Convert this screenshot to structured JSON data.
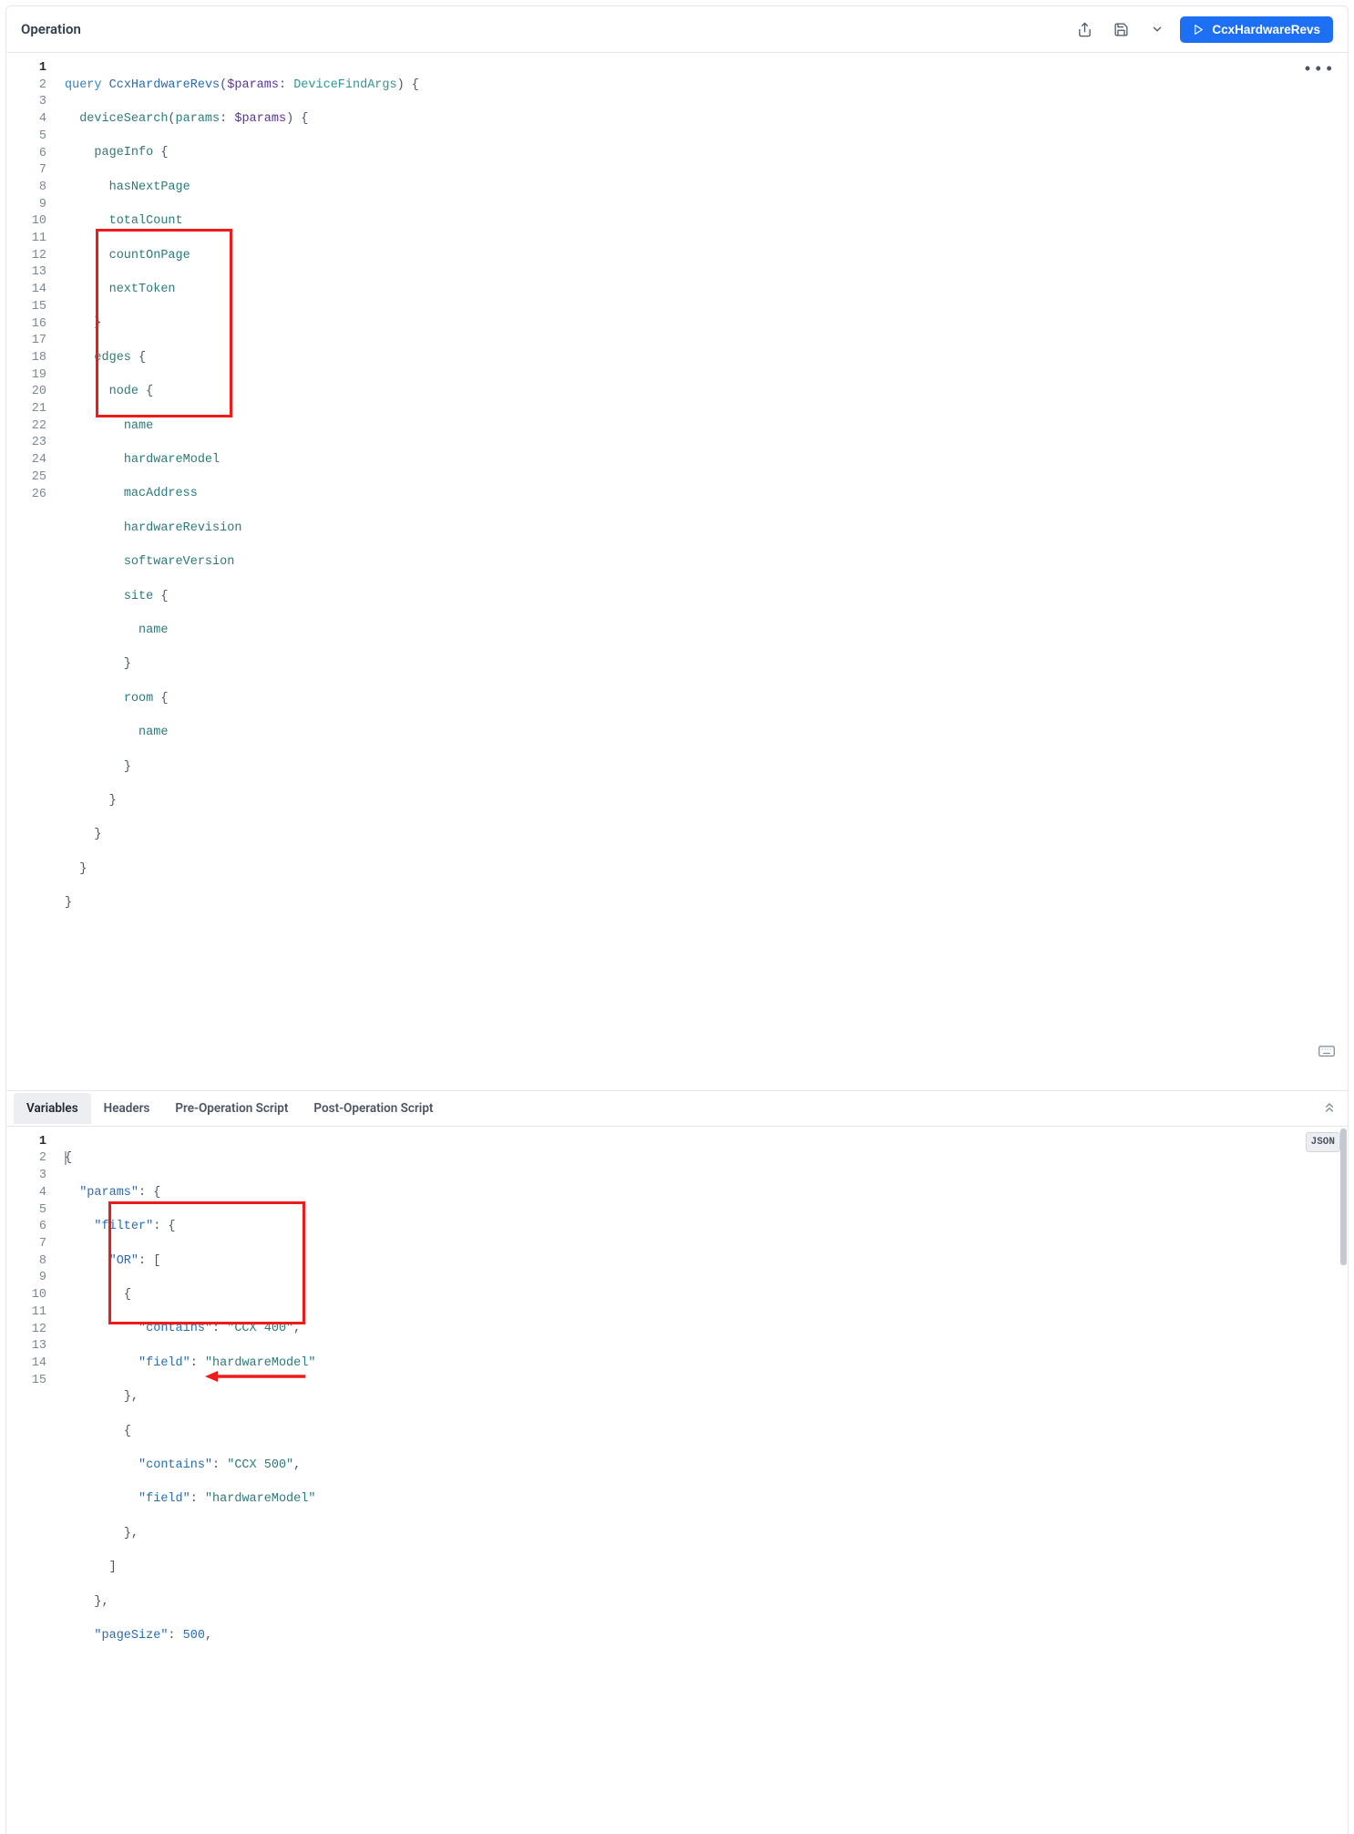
{
  "header": {
    "title": "Operation",
    "run_label": "CcxHardwareRevs"
  },
  "tabs": {
    "variables": "Variables",
    "headers": "Headers",
    "pre_op": "Pre-Operation Script",
    "post_op": "Post-Operation Script",
    "lang_badge": "JSON"
  },
  "query_lines": {
    "l1_kw": "query",
    "l1_name": "CcxHardwareRevs",
    "l1_var": "$params",
    "l1_type": "DeviceFindArgs",
    "l2_field": "deviceSearch",
    "l2_arg": "params",
    "l2_var": "$params",
    "l3": "pageInfo",
    "l4": "hasNextPage",
    "l5": "totalCount",
    "l6": "countOnPage",
    "l7": "nextToken",
    "l9": "edges",
    "l10": "node",
    "l11": "name",
    "l12": "hardwareModel",
    "l13": "macAddress",
    "l14": "hardwareRevision",
    "l15": "softwareVersion",
    "l16": "site",
    "l17": "name",
    "l19": "room",
    "l20": "name"
  },
  "vars_lines": {
    "l2_key": "\"params\"",
    "l3_key": "\"filter\"",
    "l4_key": "\"OR\"",
    "l6_key": "\"contains\"",
    "l6_val": "\"CCX 400\"",
    "l7_key": "\"field\"",
    "l7_val": "\"hardwareModel\"",
    "l10_key": "\"contains\"",
    "l10_val": "\"CCX 500\"",
    "l11_key": "\"field\"",
    "l11_val": "\"hardwareModel\"",
    "l15_key": "\"pageSize\"",
    "l15_val": "500"
  },
  "op_line_count": 26,
  "vars_line_count": 15
}
